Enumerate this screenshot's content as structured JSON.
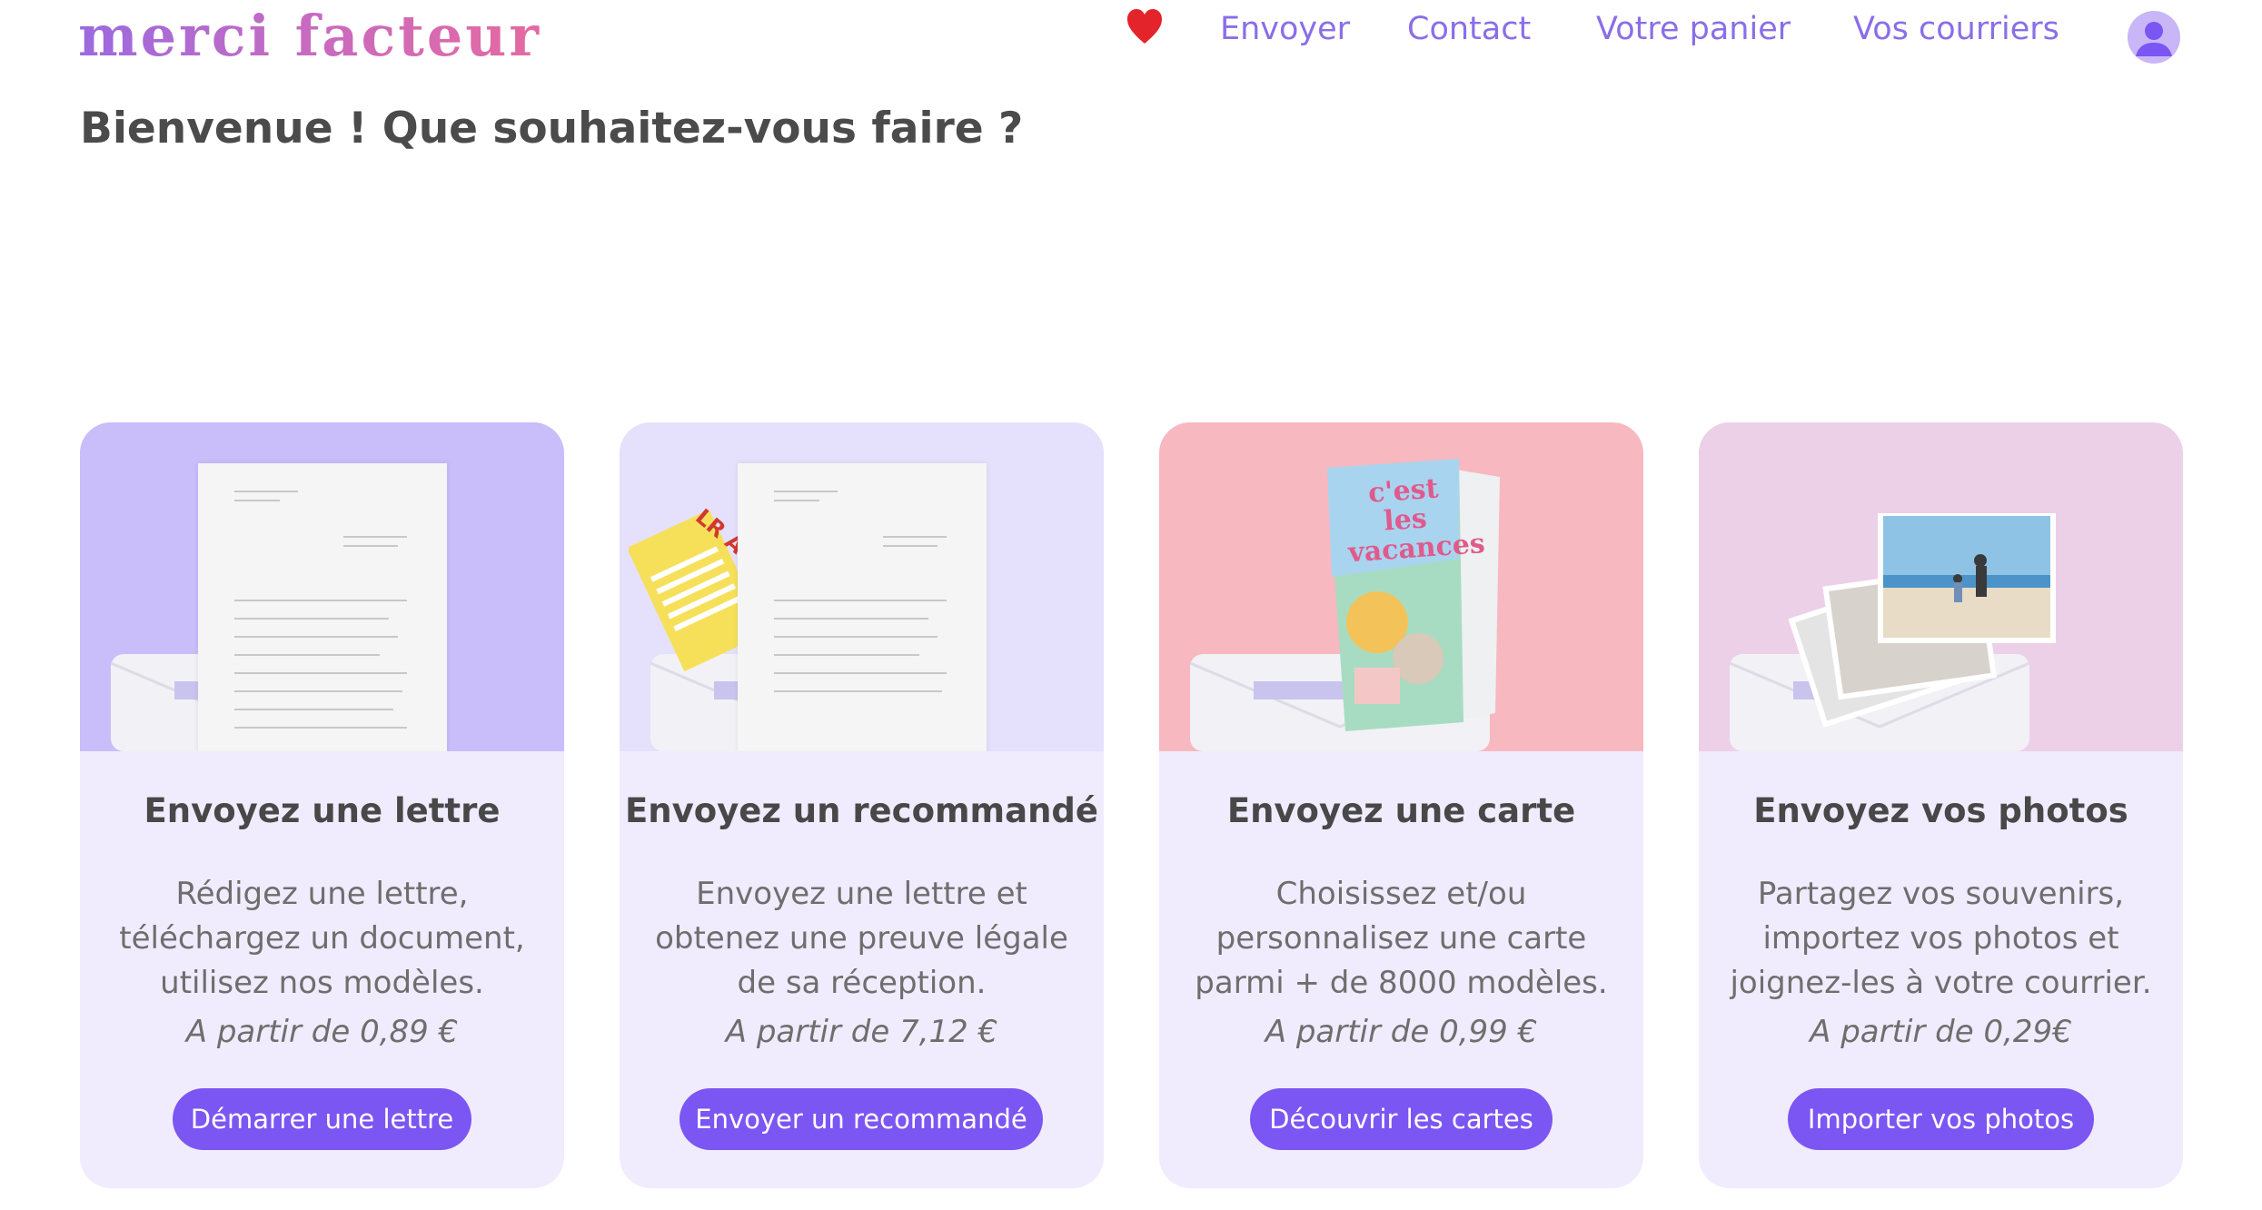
{
  "header": {
    "logo": "merci facteur",
    "nav": [
      "Envoyer",
      "Contact",
      "Votre panier",
      "Vos courriers"
    ]
  },
  "icons": {
    "favorites": "heart-icon",
    "account": "user-avatar-icon"
  },
  "page": {
    "title": "Bienvenue ! Que souhaitez-vous faire ?"
  },
  "cards": [
    {
      "title": "Envoyez une lettre",
      "desc": [
        "Rédigez une lettre,",
        "téléchargez un document,",
        "utilisez nos modèles."
      ],
      "price": "A partir de 0,89 €",
      "button": "Démarrer une lettre",
      "bg": "#c9bdfa"
    },
    {
      "title": "Envoyez un recommandé",
      "desc": [
        "Envoyez une lettre et",
        "obtenez une preuve légale",
        "de sa réception."
      ],
      "price": "A partir de 7,12 €",
      "button": "Envoyer un recommandé",
      "bg": "#e5e0fc",
      "badge": "LR AR"
    },
    {
      "title": "Envoyez une carte",
      "desc": [
        "Choisissez et/ou",
        "personnalisez une carte",
        "parmi + de 8000 modèles."
      ],
      "price": "A partir de 0,99 €",
      "button": "Découvrir les cartes",
      "bg": "#f7b8c0",
      "card_text": "c'est les vacances"
    },
    {
      "title": "Envoyez vos photos",
      "desc": [
        "Partagez vos souvenirs,",
        "importez vos photos et",
        "joignez-les à votre courrier."
      ],
      "price": "A partir de 0,29€",
      "button": "Importer vos photos",
      "bg": "#ecd0e8"
    }
  ],
  "colors": {
    "accent": "#7b56f2",
    "nav_link": "#8a6ee8",
    "card_body": "#f0ecfd"
  }
}
